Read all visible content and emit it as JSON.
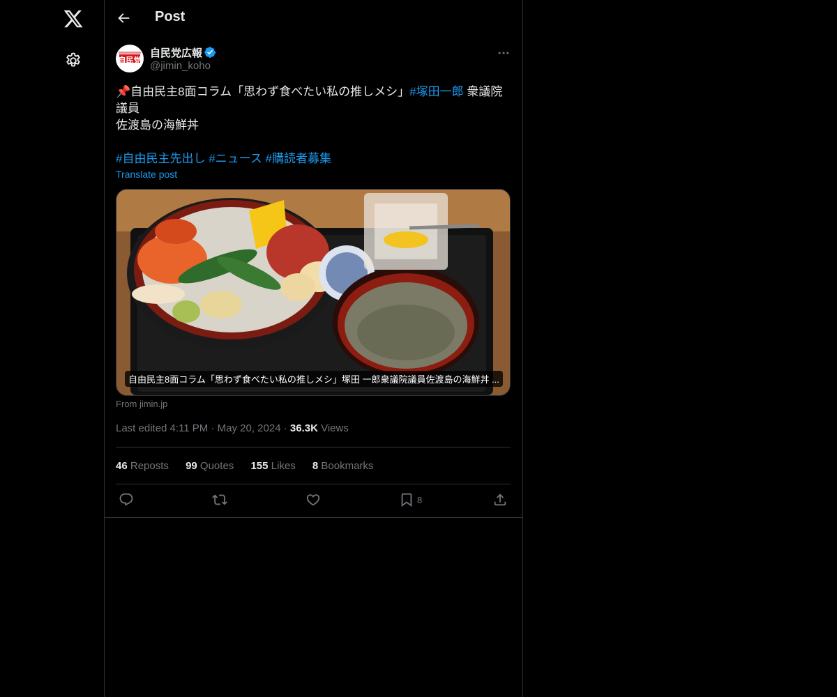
{
  "header": {
    "title": "Post"
  },
  "author": {
    "name": "自民党広報",
    "handle": "@jimin_koho",
    "avatar_text": "自民党"
  },
  "post": {
    "line1_prefix": "📌自由民主8面コラム「思わず食べたい私の推しメシ」",
    "line1_hashtag": "#塚田一郎",
    "line1_suffix": " 衆議院",
    "line2": "議員",
    "line3": "佐渡島の海鮮丼",
    "hashtags": [
      "#自由民主先出し",
      "#ニュース",
      "#購読者募集"
    ],
    "translate_label": "Translate post"
  },
  "media": {
    "caption": "自由民主8面コラム「思わず食べたい私の推しメシ」塚田 一郎衆議院議員佐渡島の海鮮丼 ...",
    "source": "From jimin.jp"
  },
  "meta": {
    "edited": "Last edited 4:11 PM",
    "date": "May 20, 2024",
    "views_count": "36.3K",
    "views_label": "Views"
  },
  "stats": [
    {
      "count": "46",
      "label": "Reposts"
    },
    {
      "count": "99",
      "label": "Quotes"
    },
    {
      "count": "155",
      "label": "Likes"
    },
    {
      "count": "8",
      "label": "Bookmarks"
    }
  ],
  "actions": {
    "bookmark_count": "8"
  },
  "colors": {
    "accent": "#1d9bf0",
    "background": "#000000",
    "border": "#2f3336",
    "muted": "#71767b"
  },
  "icons": [
    "x-logo-icon",
    "gear-icon",
    "back-arrow-icon",
    "verified-badge-icon",
    "more-icon",
    "reply-icon",
    "repost-icon",
    "like-icon",
    "bookmark-icon",
    "share-icon"
  ]
}
